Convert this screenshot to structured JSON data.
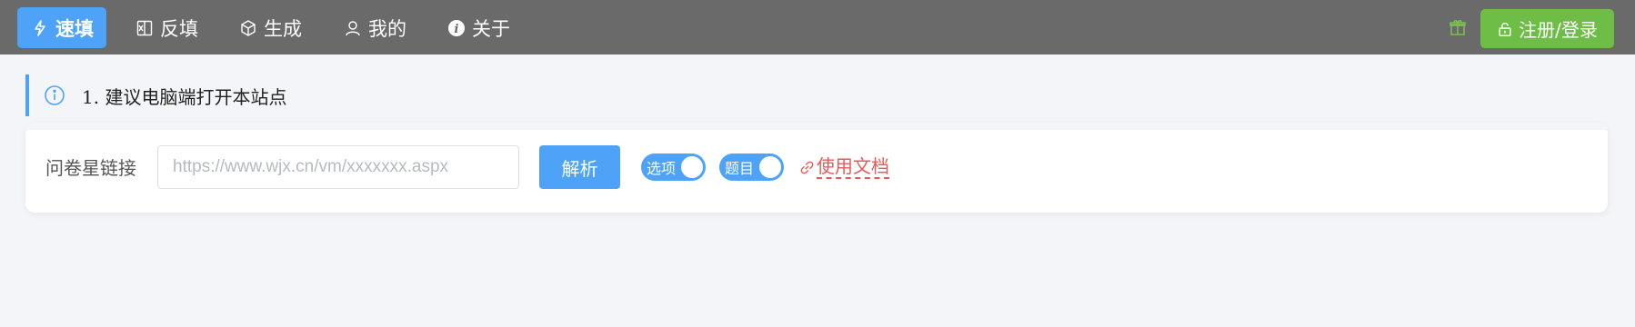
{
  "nav": {
    "items": [
      {
        "label": "速填",
        "icon": "lightning-icon",
        "active": true
      },
      {
        "label": "反填",
        "icon": "excel-icon",
        "active": false
      },
      {
        "label": "生成",
        "icon": "cube-icon",
        "active": false
      },
      {
        "label": "我的",
        "icon": "user-icon",
        "active": false
      },
      {
        "label": "关于",
        "icon": "info-icon",
        "active": false
      }
    ],
    "gift_icon": "gift-icon",
    "login_label": "注册/登录",
    "login_icon": "unlock-icon"
  },
  "notice": {
    "icon": "info-circle-icon",
    "text": "1. 建议电脑端打开本站点"
  },
  "form": {
    "label": "问卷星链接",
    "input_value": "",
    "input_placeholder": "https://www.wjx.cn/vm/xxxxxxx.aspx",
    "parse_label": "解析",
    "toggle_options_label": "选项",
    "toggle_options_on": true,
    "toggle_questions_label": "题目",
    "toggle_questions_on": true,
    "doc_link_label": "使用文档",
    "doc_link_icon": "link-icon"
  },
  "colors": {
    "topbar": "#6a6a6a",
    "primary": "#4ea3f8",
    "success": "#6ebd47",
    "link": "#e85a5a",
    "background": "#f4f5f9"
  }
}
